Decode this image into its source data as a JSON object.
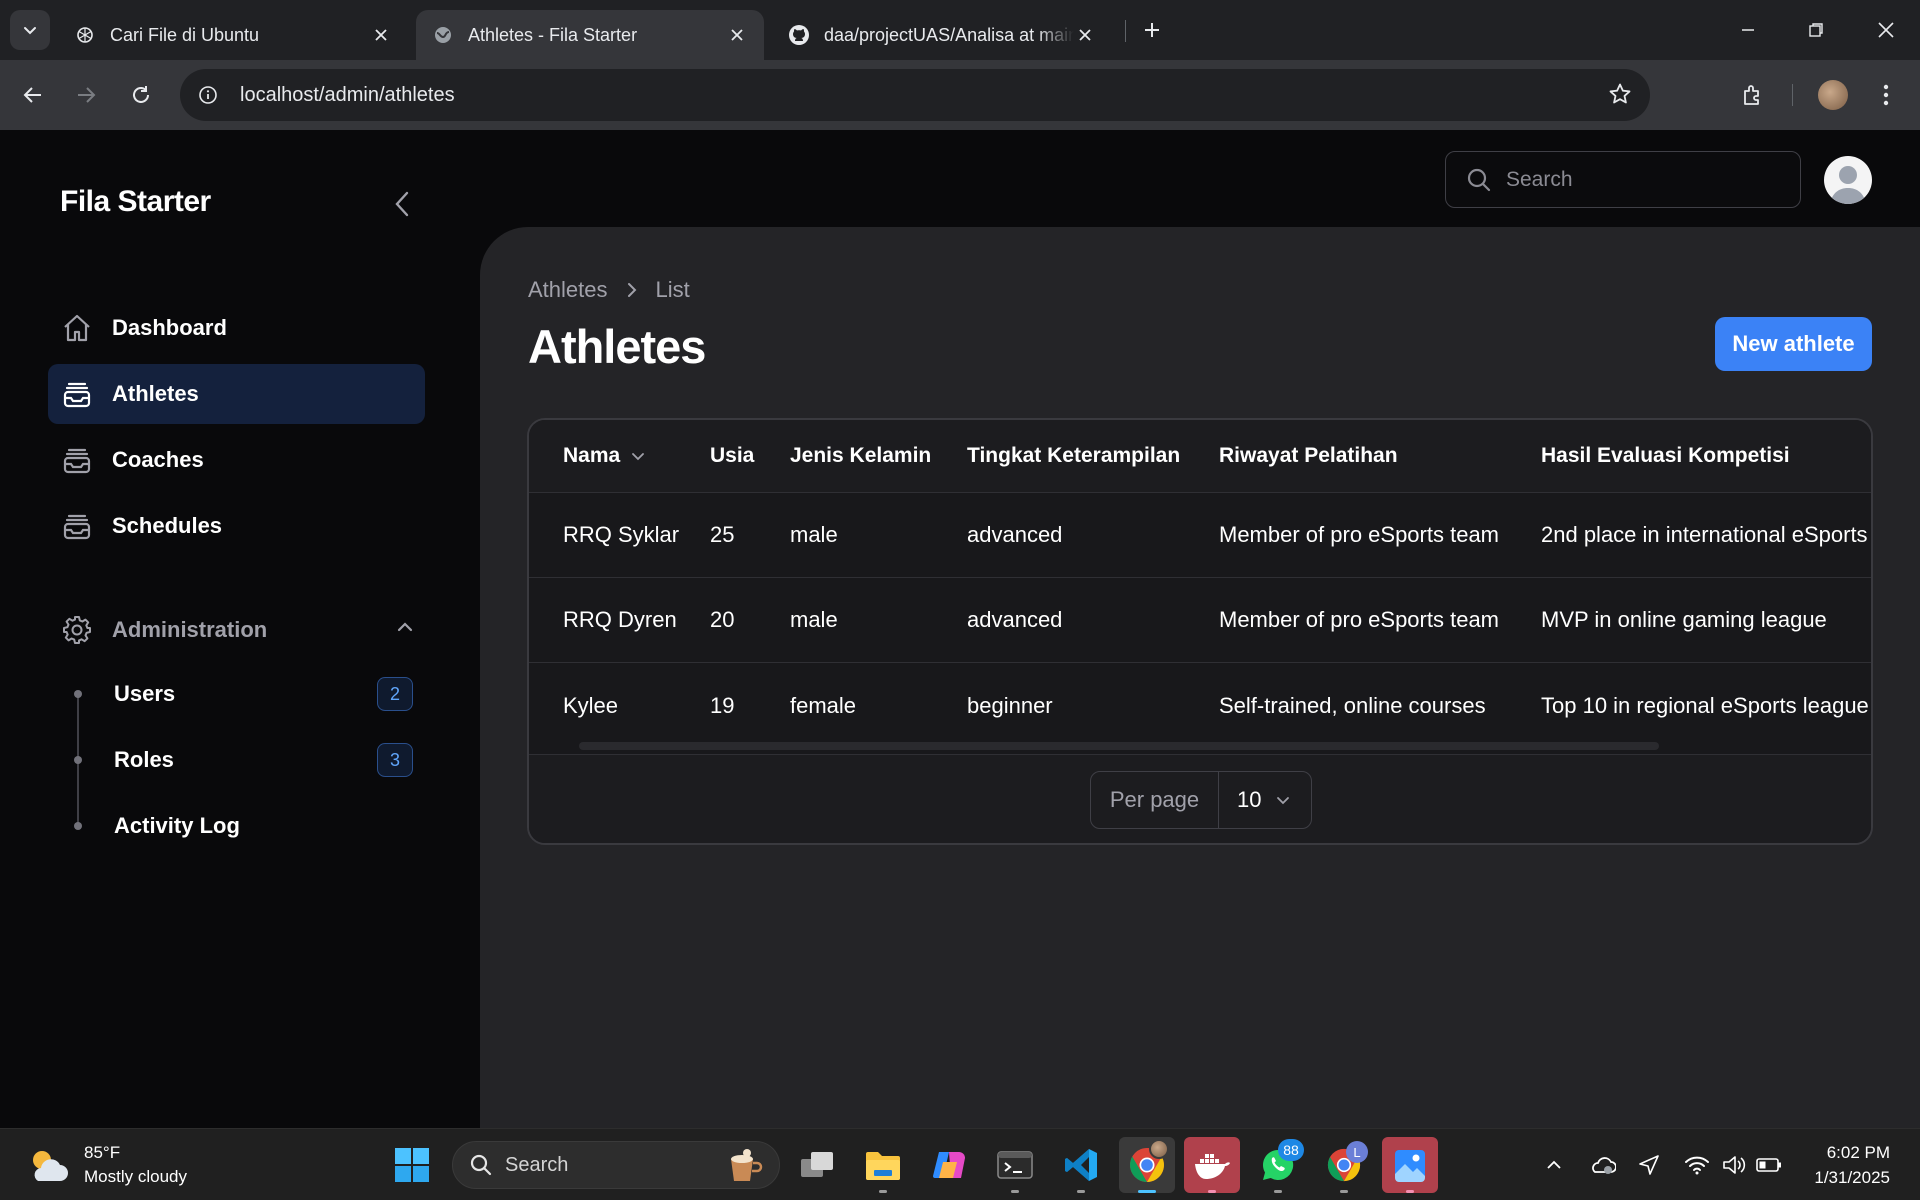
{
  "browser": {
    "tabs": [
      {
        "title": "Cari File di Ubuntu",
        "icon": "openai-icon",
        "active": false
      },
      {
        "title": "Athletes - Fila Starter",
        "icon": "globe-icon",
        "active": true
      },
      {
        "title": "daa/projectUAS/Analisa at main",
        "icon": "github-icon",
        "active": false
      }
    ],
    "url": "localhost/admin/athletes"
  },
  "app": {
    "brand": "Fila Starter",
    "search_placeholder": "Search",
    "nav": [
      {
        "label": "Dashboard",
        "icon": "home-icon",
        "active": false
      },
      {
        "label": "Athletes",
        "icon": "inbox-stack-icon",
        "active": true
      },
      {
        "label": "Coaches",
        "icon": "inbox-stack-icon",
        "active": false
      },
      {
        "label": "Schedules",
        "icon": "inbox-stack-icon",
        "active": false
      }
    ],
    "admin_group": {
      "label": "Administration",
      "items": [
        {
          "label": "Users",
          "badge": "2"
        },
        {
          "label": "Roles",
          "badge": "3"
        },
        {
          "label": "Activity Log",
          "badge": ""
        }
      ]
    }
  },
  "page": {
    "breadcrumb": [
      "Athletes",
      "List"
    ],
    "title": "Athletes",
    "new_button": "New athlete",
    "table": {
      "columns": [
        "Nama",
        "Usia",
        "Jenis Kelamin",
        "Tingkat Keterampilan",
        "Riwayat Pelatihan",
        "Hasil Evaluasi Kompetisi"
      ],
      "rows": [
        [
          "RRQ Syklar",
          "25",
          "male",
          "advanced",
          "Member of pro eSports team",
          "2nd place in international eSports"
        ],
        [
          "RRQ Dyren",
          "20",
          "male",
          "advanced",
          "Member of pro eSports team",
          "MVP in online gaming league"
        ],
        [
          "Kylee",
          "19",
          "female",
          "beginner",
          "Self-trained, online courses",
          "Top 10 in regional eSports league"
        ]
      ]
    },
    "per_page_label": "Per page",
    "per_page_value": "10"
  },
  "taskbar": {
    "weather_temp": "85°F",
    "weather_desc": "Mostly cloudy",
    "search_label": "Search",
    "whatsapp_badge": "88",
    "chrome_profile_badge": "L",
    "time": "6:02 PM",
    "date": "1/31/2025"
  }
}
